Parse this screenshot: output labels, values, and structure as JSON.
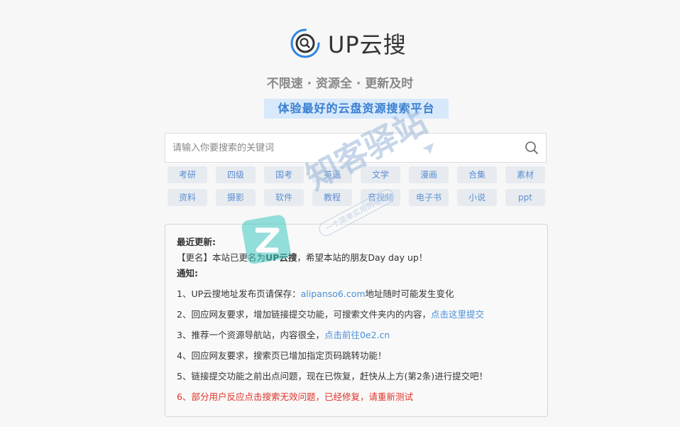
{
  "logo": {
    "text": "UP云搜",
    "icon": "search-icon",
    "accent": "#2f86e0"
  },
  "slogan": "不限速 · 资源全 · 更新及时",
  "sub_slogan": "体验最好的云盘资源搜索平台",
  "search": {
    "placeholder": "请输入你要搜索的关键词",
    "value": ""
  },
  "tags": [
    "考研",
    "四级",
    "国考",
    "英语",
    "文学",
    "漫画",
    "合集",
    "素材",
    "资料",
    "摄影",
    "软件",
    "教程",
    "音视频",
    "电子书",
    "小说",
    "ppt"
  ],
  "notice": {
    "recent_title": "最近更新:",
    "rename_prefix": "【更名】本站已更名为",
    "rename_name": "UP云搜",
    "rename_suffix": "，希望本站的朋友Day day up！",
    "notice_title": "通知:",
    "item1_pre": "1、UP云搜地址发布页请保存：",
    "item1_link": "alipanso6.com",
    "item1_post": "地址随时可能发生变化",
    "item2_pre": "2、回应网友要求，增加链接提交功能，可搜索文件夹内的内容，",
    "item2_link": "点击这里提交",
    "item3_pre": "3、推荐一个资源导航站，内容很全，",
    "item3_link": "点击前往0e2.cn",
    "item4": "4、回应网友要求，搜索页已增加指定页码跳转功能！",
    "item5": "5、链接提交功能之前出点问题，现在已恢复，赶快从上方(第2条)进行提交吧！",
    "item6": "6、部分用户反应点击搜索无效问题，已经修复，请重新测试"
  },
  "watermark": {
    "text": "知客驿站",
    "sub": "一个简单实用的导航"
  }
}
